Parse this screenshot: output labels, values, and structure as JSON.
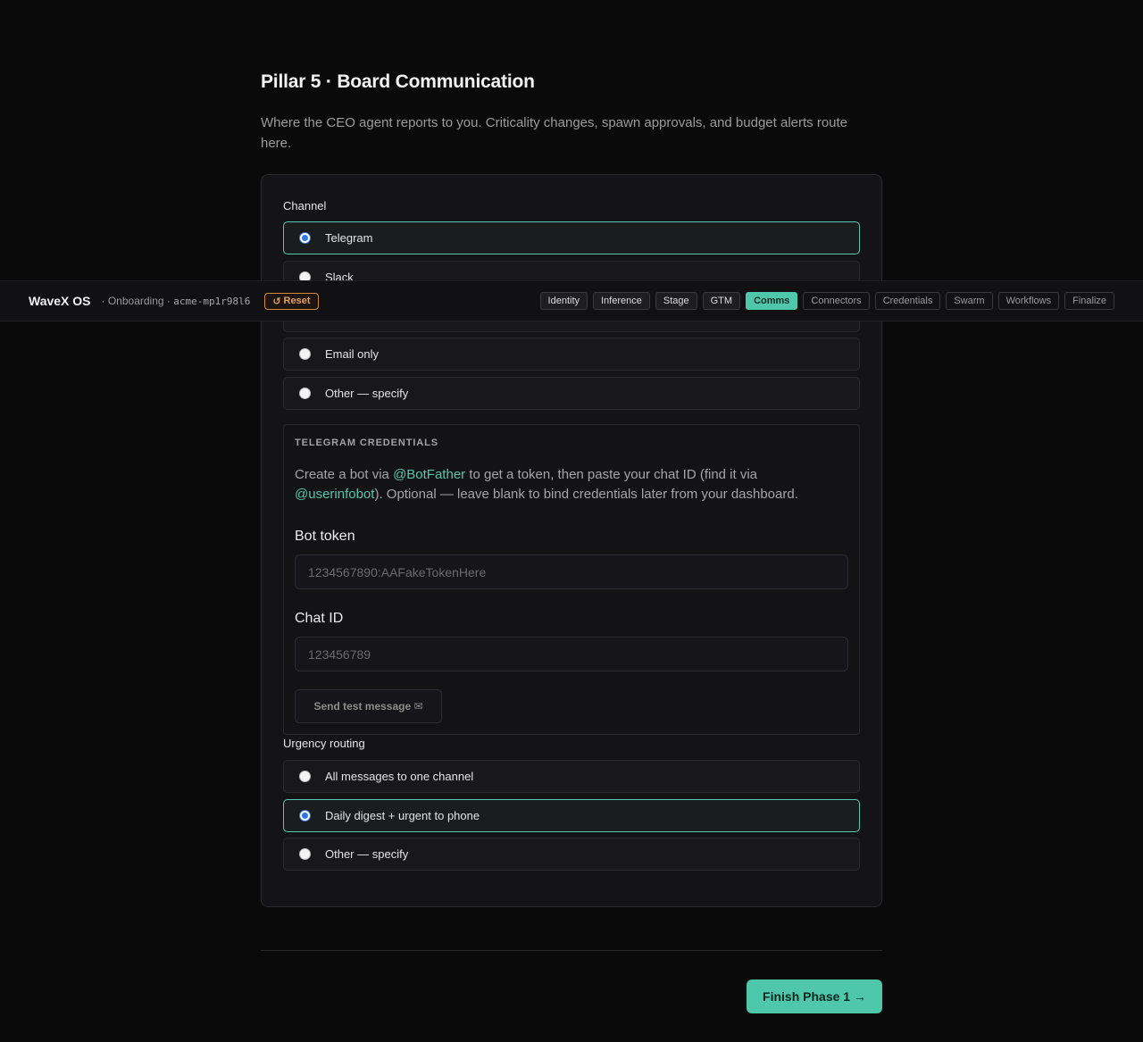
{
  "page": {
    "title": "Pillar 5 · Board Communication",
    "subtitle": "Where the CEO agent reports to you. Criticality changes, spawn approvals, and budget alerts route here."
  },
  "channel": {
    "label": "Channel",
    "options": [
      {
        "label": "Telegram",
        "selected": true
      },
      {
        "label": "Slack",
        "selected": false
      },
      {
        "label": "",
        "selected": false
      },
      {
        "label": "Email only",
        "selected": false
      },
      {
        "label": "Other — specify",
        "selected": false
      }
    ]
  },
  "telegram": {
    "heading": "TELEGRAM CREDENTIALS",
    "desc_1": "Create a bot via ",
    "link_botfather": "@BotFather",
    "desc_2": " to get a token, then paste your chat ID (find it via ",
    "link_userinfobot": "@userinfobot",
    "desc_3": "). Optional — leave blank to bind credentials later from your dashboard.",
    "bot_token_label": "Bot token",
    "bot_token_placeholder": "1234567890:AAFakeTokenHere",
    "chat_id_label": "Chat ID",
    "chat_id_placeholder": "123456789",
    "test_button": "Send test message ✉"
  },
  "urgency": {
    "label": "Urgency routing",
    "options": [
      {
        "label": "All messages to one channel",
        "selected": false
      },
      {
        "label": "Daily digest + urgent to phone",
        "selected": true
      },
      {
        "label": "Other — specify",
        "selected": false
      }
    ]
  },
  "footer": {
    "finish_button": "Finish Phase 1 →"
  },
  "topbar": {
    "brand": "WaveX OS",
    "crumb_prefix": "· Onboarding · ",
    "workspace_id": "acme-mp1r98l6",
    "reset_label": "Reset",
    "reset_icon": "↺",
    "tabs": [
      "Identity",
      "Inference",
      "Stage",
      "GTM",
      "Comms",
      "Connectors",
      "Credentials",
      "Swarm",
      "Workflows",
      "Finalize"
    ],
    "active_tab": "Comms"
  },
  "colors": {
    "accent": "#4fc7aa",
    "radio_selected": "#2f76e8",
    "reset": "#e3a05a",
    "background": "#0a0a0a"
  }
}
